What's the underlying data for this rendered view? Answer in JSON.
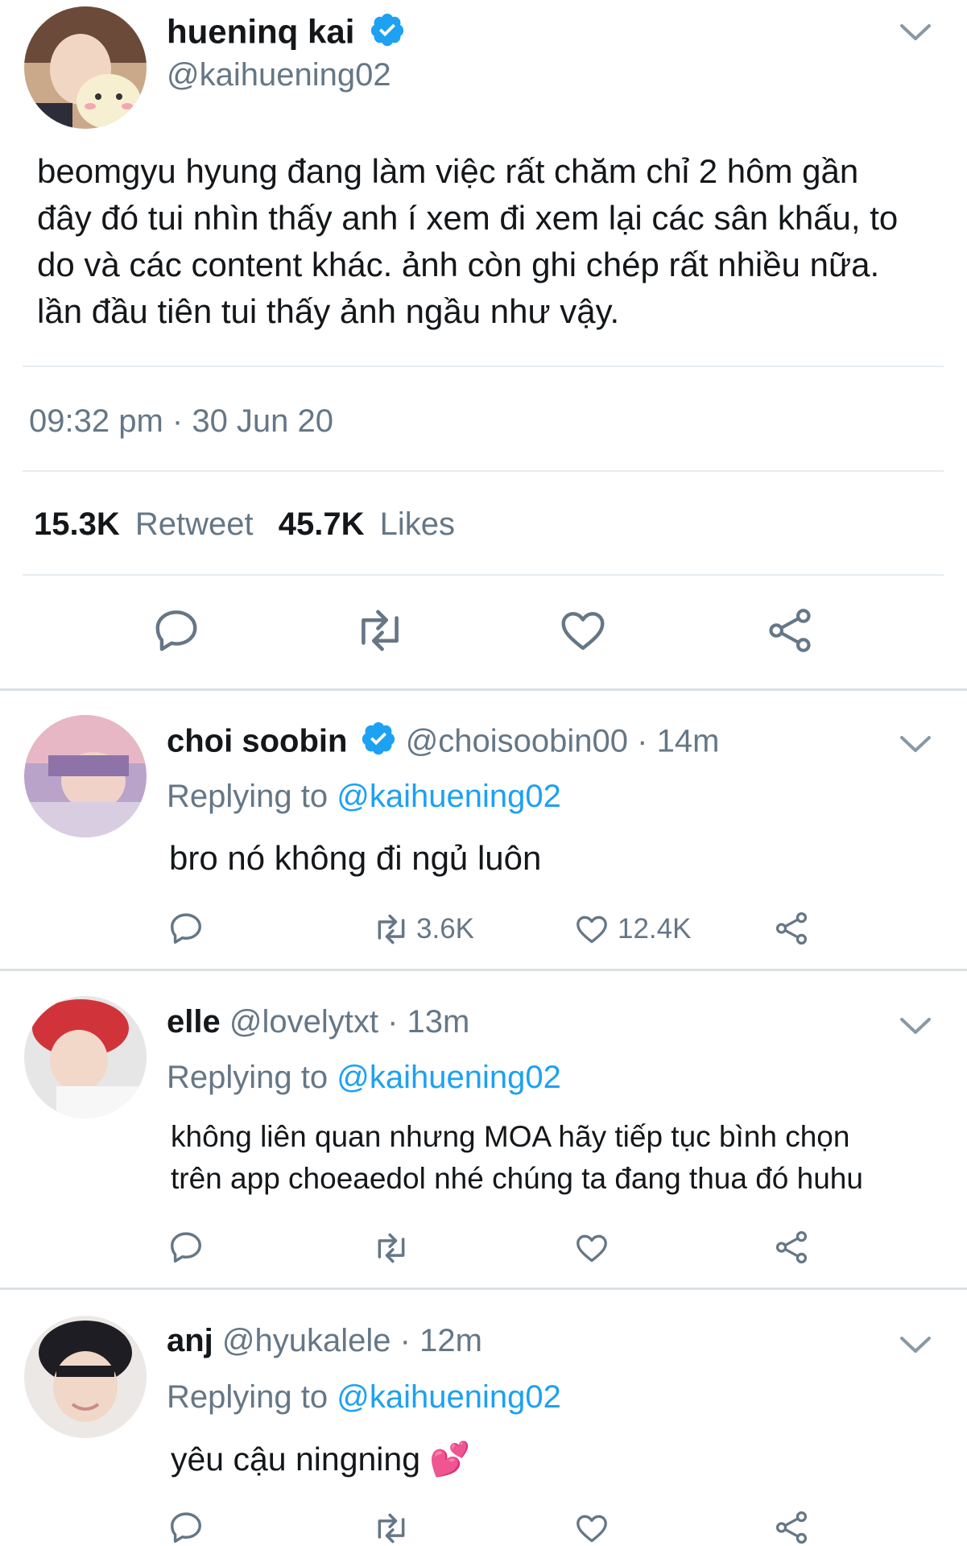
{
  "tweet": {
    "author_name": "hueninq kai",
    "author_handle": "@kaihuening02",
    "text_lines": [
      "beomgyu hyung đang làm việc rất chăm chỉ 2 hôm gần",
      "đây đó tui nhìn thấy anh í xem đi xem lại các sân khấu, to",
      "do và các content khác. ảnh còn ghi chép rất nhiều nữa.",
      "lần đầu tiên tui thấy ảnh ngầu như vậy."
    ],
    "timestamp": "09:32 pm · 30 Jun 20",
    "retweet_count": "15.3K",
    "retweet_label": "Retweet",
    "like_count": "45.7K",
    "like_label": "Likes"
  },
  "replies": [
    {
      "name": "choi soobin",
      "verified": true,
      "handle": "@choisoobin00",
      "time": "· 14m",
      "replying_label": "Replying to",
      "replying_handle": "@kaihuening02",
      "text_lines": [
        "bro nó không đi ngủ luôn"
      ],
      "retweets": "3.6K",
      "likes": "12.4K"
    },
    {
      "name": "elle",
      "verified": false,
      "handle": "@lovelytxt",
      "time": "· 13m",
      "replying_label": "Replying to",
      "replying_handle": "@kaihuening02",
      "text_lines": [
        "không liên quan nhưng MOA hãy tiếp tục bình chọn",
        "trên app choeaedol nhé chúng ta đang thua đó huhu"
      ],
      "retweets": "",
      "likes": ""
    },
    {
      "name": "anj",
      "verified": false,
      "handle": "@hyukalele",
      "time": "· 12m",
      "replying_label": "Replying to",
      "replying_handle": "@kaihuening02",
      "text_lines": [
        "yêu cậu ningning 💕"
      ],
      "retweets": "",
      "likes": ""
    }
  ],
  "icons": {
    "reply": "reply-icon",
    "retweet": "retweet-icon",
    "like": "heart-icon",
    "share": "share-icon",
    "menu": "chevron-down-icon",
    "verified": "verified-badge-icon"
  },
  "colors": {
    "accent": "#1da1f2",
    "muted": "#657786",
    "text": "#14171a"
  }
}
